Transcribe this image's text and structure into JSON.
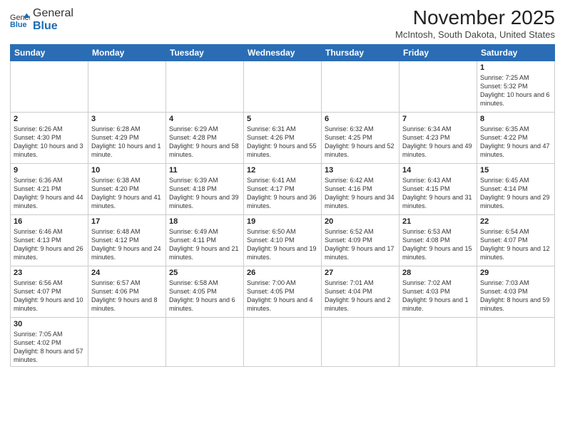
{
  "logo": {
    "text_normal": "General",
    "text_bold": "Blue"
  },
  "title": "November 2025",
  "location": "McIntosh, South Dakota, United States",
  "weekdays": [
    "Sunday",
    "Monday",
    "Tuesday",
    "Wednesday",
    "Thursday",
    "Friday",
    "Saturday"
  ],
  "weeks": [
    [
      {
        "day": "",
        "info": ""
      },
      {
        "day": "",
        "info": ""
      },
      {
        "day": "",
        "info": ""
      },
      {
        "day": "",
        "info": ""
      },
      {
        "day": "",
        "info": ""
      },
      {
        "day": "",
        "info": ""
      },
      {
        "day": "1",
        "info": "Sunrise: 7:25 AM\nSunset: 5:32 PM\nDaylight: 10 hours and 6 minutes."
      }
    ],
    [
      {
        "day": "2",
        "info": "Sunrise: 6:26 AM\nSunset: 4:30 PM\nDaylight: 10 hours and 3 minutes."
      },
      {
        "day": "3",
        "info": "Sunrise: 6:28 AM\nSunset: 4:29 PM\nDaylight: 10 hours and 1 minute."
      },
      {
        "day": "4",
        "info": "Sunrise: 6:29 AM\nSunset: 4:28 PM\nDaylight: 9 hours and 58 minutes."
      },
      {
        "day": "5",
        "info": "Sunrise: 6:31 AM\nSunset: 4:26 PM\nDaylight: 9 hours and 55 minutes."
      },
      {
        "day": "6",
        "info": "Sunrise: 6:32 AM\nSunset: 4:25 PM\nDaylight: 9 hours and 52 minutes."
      },
      {
        "day": "7",
        "info": "Sunrise: 6:34 AM\nSunset: 4:23 PM\nDaylight: 9 hours and 49 minutes."
      },
      {
        "day": "8",
        "info": "Sunrise: 6:35 AM\nSunset: 4:22 PM\nDaylight: 9 hours and 47 minutes."
      }
    ],
    [
      {
        "day": "9",
        "info": "Sunrise: 6:36 AM\nSunset: 4:21 PM\nDaylight: 9 hours and 44 minutes."
      },
      {
        "day": "10",
        "info": "Sunrise: 6:38 AM\nSunset: 4:20 PM\nDaylight: 9 hours and 41 minutes."
      },
      {
        "day": "11",
        "info": "Sunrise: 6:39 AM\nSunset: 4:18 PM\nDaylight: 9 hours and 39 minutes."
      },
      {
        "day": "12",
        "info": "Sunrise: 6:41 AM\nSunset: 4:17 PM\nDaylight: 9 hours and 36 minutes."
      },
      {
        "day": "13",
        "info": "Sunrise: 6:42 AM\nSunset: 4:16 PM\nDaylight: 9 hours and 34 minutes."
      },
      {
        "day": "14",
        "info": "Sunrise: 6:43 AM\nSunset: 4:15 PM\nDaylight: 9 hours and 31 minutes."
      },
      {
        "day": "15",
        "info": "Sunrise: 6:45 AM\nSunset: 4:14 PM\nDaylight: 9 hours and 29 minutes."
      }
    ],
    [
      {
        "day": "16",
        "info": "Sunrise: 6:46 AM\nSunset: 4:13 PM\nDaylight: 9 hours and 26 minutes."
      },
      {
        "day": "17",
        "info": "Sunrise: 6:48 AM\nSunset: 4:12 PM\nDaylight: 9 hours and 24 minutes."
      },
      {
        "day": "18",
        "info": "Sunrise: 6:49 AM\nSunset: 4:11 PM\nDaylight: 9 hours and 21 minutes."
      },
      {
        "day": "19",
        "info": "Sunrise: 6:50 AM\nSunset: 4:10 PM\nDaylight: 9 hours and 19 minutes."
      },
      {
        "day": "20",
        "info": "Sunrise: 6:52 AM\nSunset: 4:09 PM\nDaylight: 9 hours and 17 minutes."
      },
      {
        "day": "21",
        "info": "Sunrise: 6:53 AM\nSunset: 4:08 PM\nDaylight: 9 hours and 15 minutes."
      },
      {
        "day": "22",
        "info": "Sunrise: 6:54 AM\nSunset: 4:07 PM\nDaylight: 9 hours and 12 minutes."
      }
    ],
    [
      {
        "day": "23",
        "info": "Sunrise: 6:56 AM\nSunset: 4:07 PM\nDaylight: 9 hours and 10 minutes."
      },
      {
        "day": "24",
        "info": "Sunrise: 6:57 AM\nSunset: 4:06 PM\nDaylight: 9 hours and 8 minutes."
      },
      {
        "day": "25",
        "info": "Sunrise: 6:58 AM\nSunset: 4:05 PM\nDaylight: 9 hours and 6 minutes."
      },
      {
        "day": "26",
        "info": "Sunrise: 7:00 AM\nSunset: 4:05 PM\nDaylight: 9 hours and 4 minutes."
      },
      {
        "day": "27",
        "info": "Sunrise: 7:01 AM\nSunset: 4:04 PM\nDaylight: 9 hours and 2 minutes."
      },
      {
        "day": "28",
        "info": "Sunrise: 7:02 AM\nSunset: 4:03 PM\nDaylight: 9 hours and 1 minute."
      },
      {
        "day": "29",
        "info": "Sunrise: 7:03 AM\nSunset: 4:03 PM\nDaylight: 8 hours and 59 minutes."
      }
    ],
    [
      {
        "day": "30",
        "info": "Sunrise: 7:05 AM\nSunset: 4:02 PM\nDaylight: 8 hours and 57 minutes."
      },
      {
        "day": "",
        "info": ""
      },
      {
        "day": "",
        "info": ""
      },
      {
        "day": "",
        "info": ""
      },
      {
        "day": "",
        "info": ""
      },
      {
        "day": "",
        "info": ""
      },
      {
        "day": "",
        "info": ""
      }
    ]
  ]
}
